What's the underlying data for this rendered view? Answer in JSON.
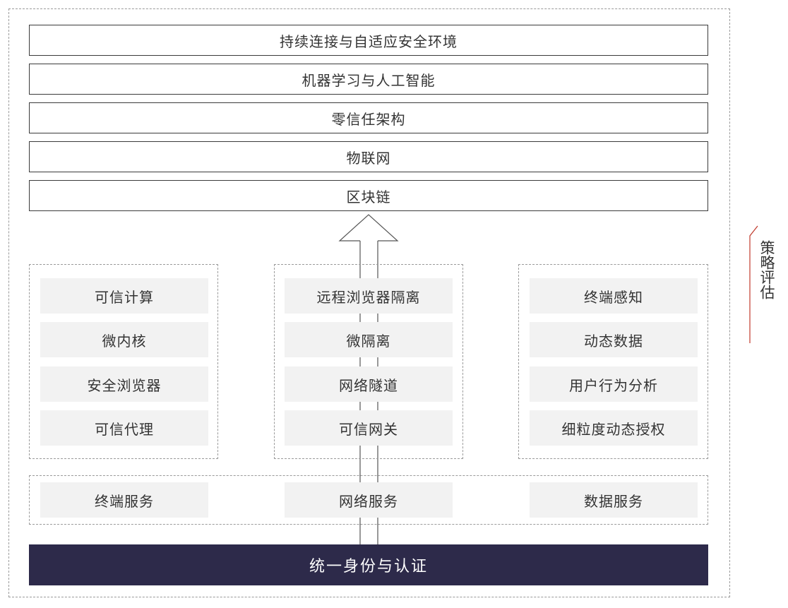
{
  "top_layers": [
    "持续连接与自适应安全环境",
    "机器学习与人工智能",
    "零信任架构",
    "物联网",
    "区块链"
  ],
  "groups": {
    "left": [
      "可信计算",
      "微内核",
      "安全浏览器",
      "可信代理"
    ],
    "middle": [
      "远程浏览器隔离",
      "微隔离",
      "网络隧道",
      "可信网关"
    ],
    "right": [
      "终端感知",
      "动态数据",
      "用户行为分析",
      "细粒度动态授权"
    ]
  },
  "services": [
    "终端服务",
    "网络服务",
    "数据服务"
  ],
  "bottom_label": "统一身份与认证",
  "side_label": "策略评估",
  "colors": {
    "bottom_bar": "#2d2a4a",
    "cell_bg": "#f2f2f2",
    "side_bracket": "#c0392b"
  }
}
